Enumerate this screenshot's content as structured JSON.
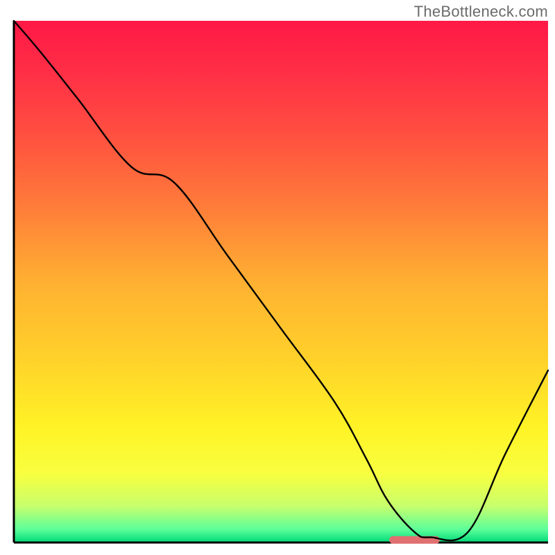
{
  "watermark": "TheBottleneck.com",
  "chart_data": {
    "type": "line",
    "title": "",
    "xlabel": "",
    "ylabel": "",
    "xlim": [
      0,
      100
    ],
    "ylim": [
      0,
      100
    ],
    "axes": {
      "left": true,
      "bottom": true,
      "right": false,
      "top": false,
      "ticks": false,
      "grid": false
    },
    "background_gradient": {
      "stops": [
        {
          "offset": 0.0,
          "color": "#ff1846"
        },
        {
          "offset": 0.1,
          "color": "#ff2f46"
        },
        {
          "offset": 0.22,
          "color": "#ff5040"
        },
        {
          "offset": 0.35,
          "color": "#ff7a3a"
        },
        {
          "offset": 0.5,
          "color": "#ffb032"
        },
        {
          "offset": 0.65,
          "color": "#ffd22a"
        },
        {
          "offset": 0.78,
          "color": "#fff326"
        },
        {
          "offset": 0.87,
          "color": "#f7ff40"
        },
        {
          "offset": 0.93,
          "color": "#c7ff6c"
        },
        {
          "offset": 0.975,
          "color": "#5cff9a"
        },
        {
          "offset": 1.0,
          "color": "#00d878"
        }
      ]
    },
    "series": [
      {
        "name": "bottleneck-curve",
        "color": "#000000",
        "width": 2.4,
        "x": [
          0,
          5,
          12,
          22,
          30,
          40,
          50,
          60,
          66,
          70,
          75,
          78,
          85,
          92,
          100
        ],
        "y": [
          100,
          94,
          85,
          72,
          69,
          55,
          41,
          27,
          16,
          8,
          2,
          1,
          2,
          17,
          33
        ]
      }
    ],
    "markers": [
      {
        "name": "optimal-range",
        "type": "bar-segment",
        "x_start": 71,
        "x_end": 79,
        "y": 0.5,
        "color": "#e07070",
        "thickness": 11,
        "cap": "round"
      }
    ]
  }
}
